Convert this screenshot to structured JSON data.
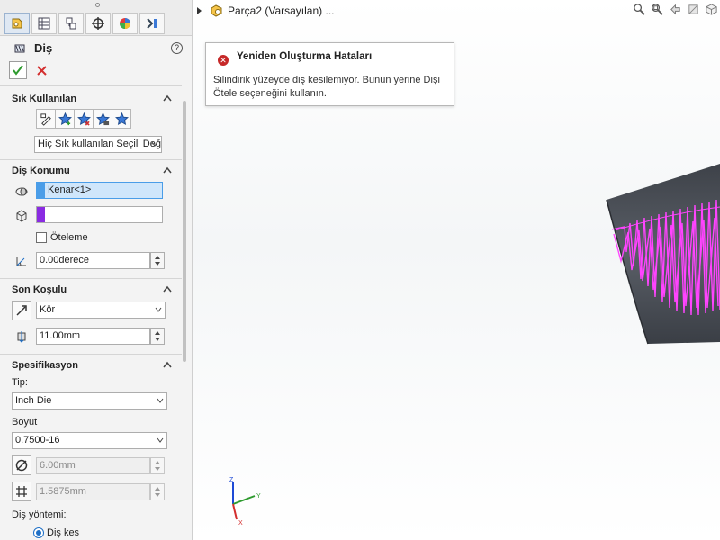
{
  "panel": {
    "title": "Diş",
    "tabs": [
      {
        "name": "feature-manager-tab",
        "icon": "feature-tree-icon",
        "active": true
      },
      {
        "name": "property-manager-tab",
        "icon": "property-list-icon",
        "active": false
      },
      {
        "name": "configuration-manager-tab",
        "icon": "configuration-icon",
        "active": false
      },
      {
        "name": "dimxpert-tab",
        "icon": "crosshair-icon",
        "active": false
      },
      {
        "name": "display-manager-tab",
        "icon": "display-pie-icon",
        "active": false
      },
      {
        "name": "more-tab",
        "icon": "more-icon",
        "active": false
      }
    ],
    "favorites": {
      "title": "Sık Kullanılan",
      "select_value": "Hiç Sık kullanılan Seçili Değ"
    },
    "location": {
      "title": "Diş Konumu",
      "edge_value": "Kenar<1>",
      "face_value": "",
      "offset_label": "Öteleme",
      "angle_value": "0.00derece"
    },
    "end_condition": {
      "title": "Son Koşulu",
      "type_value": "Kör",
      "depth_value": "11.00mm"
    },
    "specification": {
      "title": "Spesifikasyon",
      "type_label": "Tip:",
      "type_value": "Inch Die",
      "size_label": "Boyut",
      "size_value": "0.7500-16",
      "diameter_value": "6.00mm",
      "pitch_value": "1.5875mm",
      "method_label": "Diş yöntemi:",
      "method_option": "Diş kes"
    }
  },
  "viewport": {
    "tree_root": "Parça2 (Varsayılan) ...",
    "error": {
      "title": "Yeniden Oluşturma Hataları",
      "message": "Silindirik yüzeyde diş kesilemiyor. Bunun yerine Dişi Ötele seçeneğini kullanın."
    },
    "triad": {
      "x": "X",
      "y": "Y",
      "z": "Z"
    }
  },
  "colors": {
    "edge_swatch": "#4a9de8",
    "face_swatch": "#8a2be2",
    "thread_preview": "#ff44ff",
    "model_body": "#4a4f57",
    "error_red": "#c62828",
    "ok_green": "#2e9b2e"
  }
}
